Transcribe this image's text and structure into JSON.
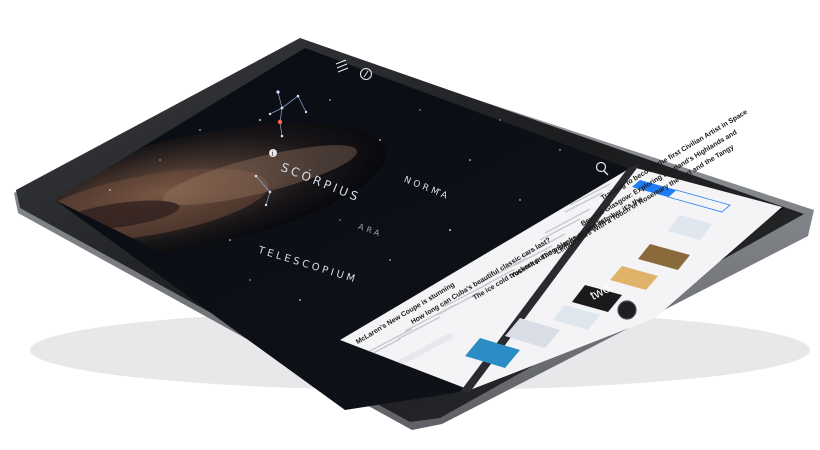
{
  "sky_app": {
    "labels": {
      "scorpius": "SCORPIUS",
      "telescopium": "TELESCOPIUM",
      "norma": "NORMA",
      "ara": "ARA"
    },
    "icons": [
      "menu-icon",
      "compass-icon",
      "search-icon",
      "info-icon"
    ]
  },
  "news_app": {
    "segment_selected": "Section",
    "articles": [
      "Training to become the first Civilian Artist in Space",
      "Beyond Glasgow: Exploring Scotland's Highlands and",
      "Lemon Bars With a Touch of Rosemary the Tart and the Tangy",
      "Yosemite: The most important number it's the",
      "The ice cold truckers putting Alaska on the list",
      "How long can Cuba's beautiful classic cars last?",
      "McLaren's New Coupe is stunning"
    ],
    "thumb_brand": "two"
  }
}
